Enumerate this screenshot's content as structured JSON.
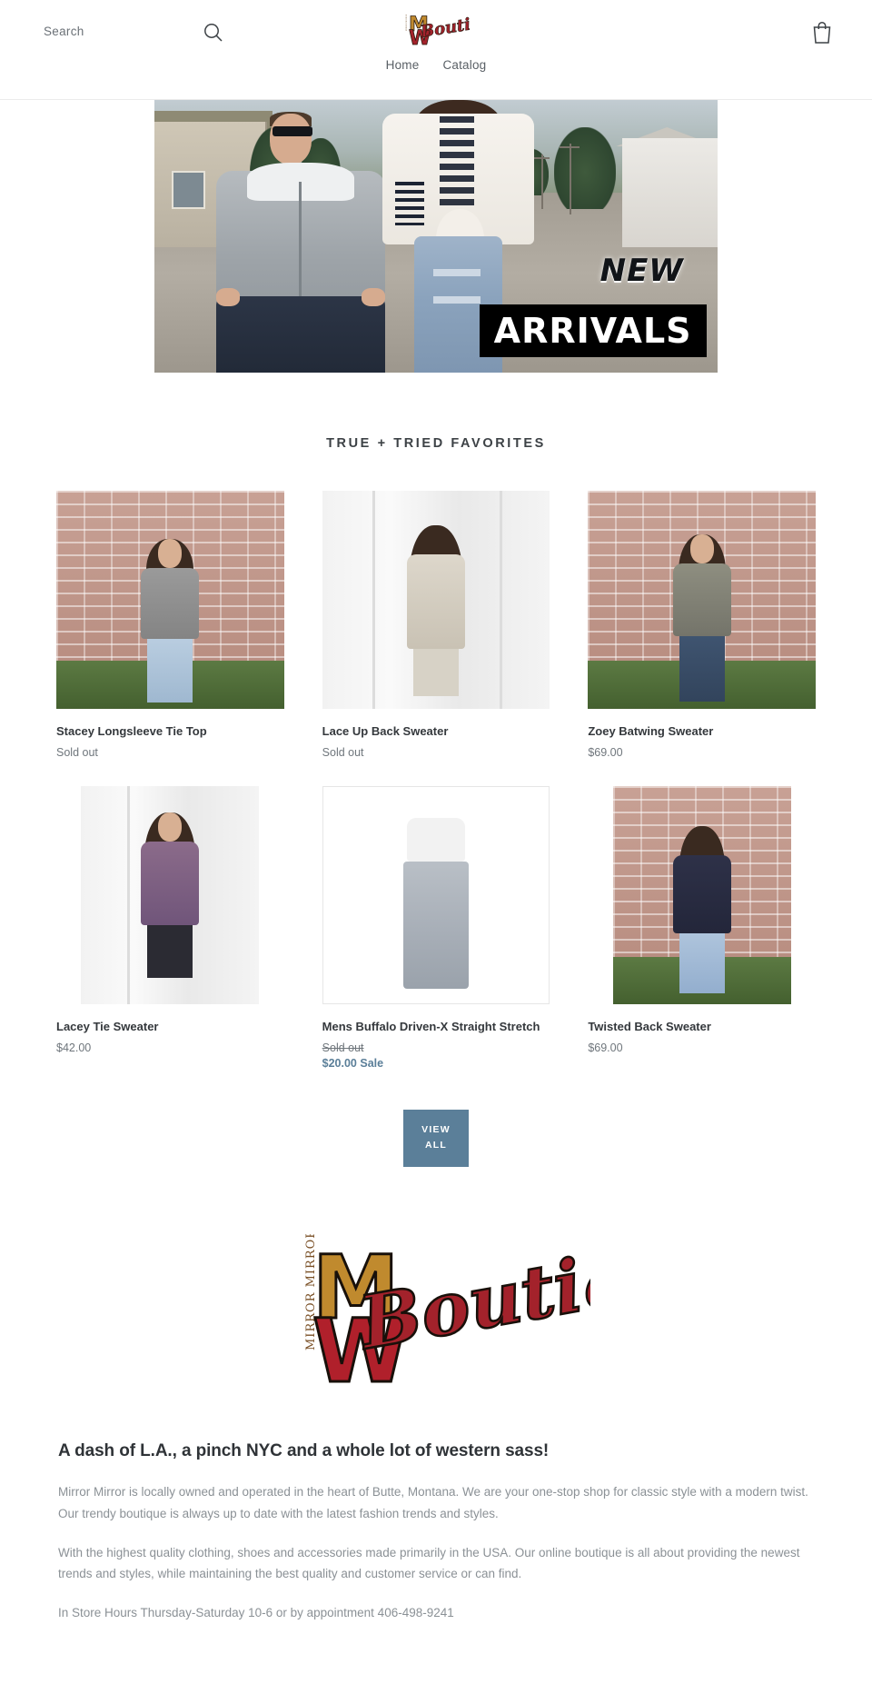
{
  "header": {
    "search": {
      "placeholder": "Search",
      "value": "",
      "icon": "search-icon"
    },
    "logo": {
      "alt": "Mirror Mirror Boutique",
      "line_top": "M",
      "line_bottom": "W",
      "script": "Boutique",
      "vertical": "MIRROR MIRROR"
    },
    "cart": {
      "icon": "cart-icon",
      "label": "Cart"
    },
    "nav": [
      {
        "label": "Home",
        "name": "nav-home"
      },
      {
        "label": "Catalog",
        "name": "nav-catalog"
      }
    ]
  },
  "hero": {
    "name": "new-arrivals-banner",
    "overlay_top": "NEW",
    "overlay_bottom": "ARRIVALS"
  },
  "collection": {
    "title": "TRUE + TRIED FAVORITES",
    "products": [
      {
        "title": "Stacey Longsleeve Tie Top",
        "price": "Sold out",
        "sale": "",
        "struck": false
      },
      {
        "title": "Lace Up Back Sweater",
        "price": "Sold out",
        "sale": "",
        "struck": false
      },
      {
        "title": "Zoey Batwing Sweater",
        "price": "$69.00",
        "sale": "",
        "struck": false
      },
      {
        "title": "Lacey Tie Sweater",
        "price": "$42.00",
        "sale": "",
        "struck": false
      },
      {
        "title": "Mens Buffalo Driven-X Straight Stretch",
        "price": "Sold out",
        "sale": "$20.00 Sale",
        "struck": true
      },
      {
        "title": "Twisted Back Sweater",
        "price": "$69.00",
        "sale": "",
        "struck": false
      }
    ],
    "view_all": "View All"
  },
  "about": {
    "heading": "A dash of L.A., a pinch NYC and a whole lot of western sass!",
    "paragraph1": "Mirror Mirror is locally owned and operated in the heart of Butte, Montana. We are your one-stop shop for classic style with a modern twist. Our trendy boutique is always up to date with the latest fashion trends and styles.",
    "paragraph2": " With the highest quality clothing, shoes and accessories made primarily in the USA. Our online boutique is all about providing the newest trends and styles, while maintaining the best quality and customer service or can find.",
    "paragraph3": "In Store Hours Thursday-Saturday 10-6 or by appointment 406-498-9241"
  },
  "colors": {
    "accent": "#5b7f99",
    "text": "#3d4246",
    "muted": "#8b9196",
    "logo_gold": "#c08a2e",
    "logo_red": "#a3222b"
  }
}
